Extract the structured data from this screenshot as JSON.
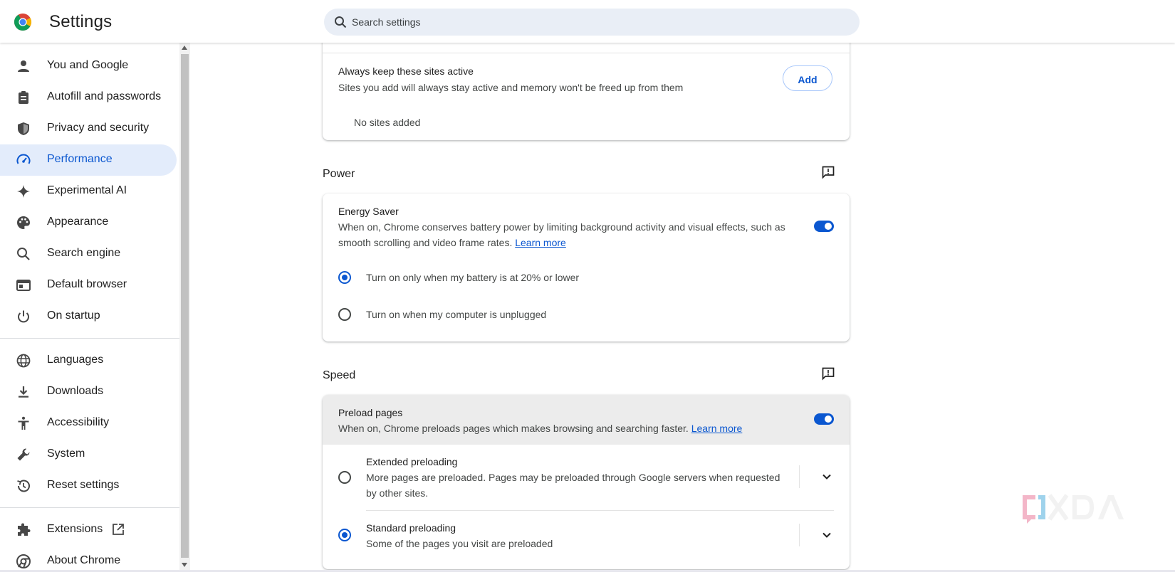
{
  "header": {
    "title": "Settings",
    "search_placeholder": "Search settings"
  },
  "sidebar": {
    "items": [
      {
        "label": "You and Google",
        "icon": "person-icon"
      },
      {
        "label": "Autofill and passwords",
        "icon": "clipboard-icon"
      },
      {
        "label": "Privacy and security",
        "icon": "shield-icon"
      },
      {
        "label": "Performance",
        "icon": "speedometer-icon",
        "active": true
      },
      {
        "label": "Experimental AI",
        "icon": "sparkle-icon"
      },
      {
        "label": "Appearance",
        "icon": "palette-icon"
      },
      {
        "label": "Search engine",
        "icon": "search-icon"
      },
      {
        "label": "Default browser",
        "icon": "browser-window-icon"
      },
      {
        "label": "On startup",
        "icon": "power-icon"
      },
      {
        "label": "Languages",
        "icon": "globe-icon"
      },
      {
        "label": "Downloads",
        "icon": "download-icon"
      },
      {
        "label": "Accessibility",
        "icon": "accessibility-icon"
      },
      {
        "label": "System",
        "icon": "wrench-icon"
      },
      {
        "label": "Reset settings",
        "icon": "history-icon"
      },
      {
        "label": "Extensions",
        "icon": "puzzle-icon"
      },
      {
        "label": "About Chrome",
        "icon": "chrome-icon"
      }
    ]
  },
  "memory": {
    "active_sites_title": "Always keep these sites active",
    "active_sites_desc": "Sites you add will always stay active and memory won't be freed up from them",
    "add_label": "Add",
    "no_sites": "No sites added"
  },
  "power": {
    "section_title": "Power",
    "energy_saver_title": "Energy Saver",
    "energy_saver_desc": "When on, Chrome conserves battery power by limiting background activity and visual effects, such as smooth scrolling and video frame rates.",
    "learn_more": "Learn more",
    "energy_saver_on": true,
    "option_battery": "Turn on only when my battery is at 20% or lower",
    "option_unplugged": "Turn on when my computer is unplugged",
    "selected": "battery"
  },
  "speed": {
    "section_title": "Speed",
    "preload_title": "Preload pages",
    "preload_desc": "When on, Chrome preloads pages which makes browsing and searching faster.",
    "learn_more": "Learn more",
    "preload_on": true,
    "extended_title": "Extended preloading",
    "extended_desc": "More pages are preloaded. Pages may be preloaded through Google servers when requested by other sites.",
    "standard_title": "Standard preloading",
    "standard_desc": "Some of the pages you visit are preloaded",
    "selected": "standard"
  },
  "colors": {
    "accent": "#0b57d0",
    "active_bg": "#e3ecfb",
    "search_bg": "#e9eef6"
  }
}
